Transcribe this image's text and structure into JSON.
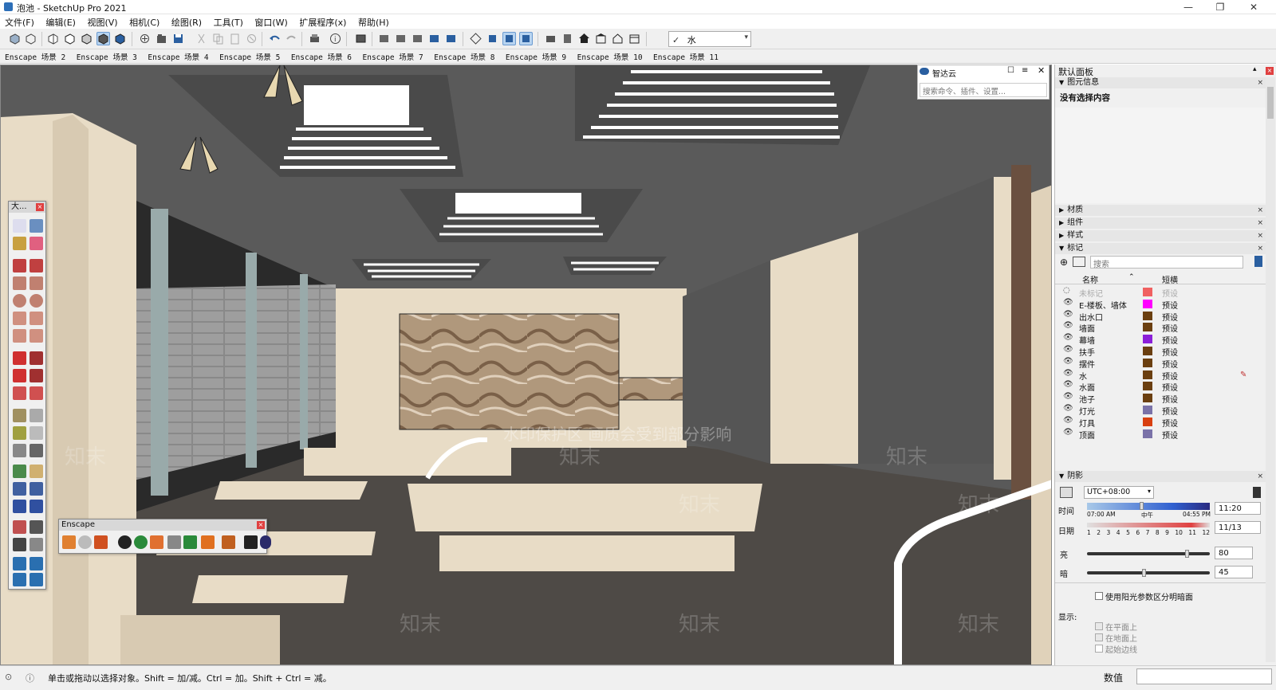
{
  "window": {
    "title": "泡池 - SketchUp Pro 2021",
    "minimize": "—",
    "maximize": "❐",
    "close": "✕"
  },
  "menu": [
    "文件(F)",
    "编辑(E)",
    "视图(V)",
    "相机(C)",
    "绘图(R)",
    "工具(T)",
    "窗口(W)",
    "扩展程序(x)",
    "帮助(H)"
  ],
  "layer_selector": {
    "check": "✓",
    "value": "水",
    "arrow": "▾"
  },
  "scenes": [
    "Enscape 场景 2",
    "Enscape 场景 3",
    "Enscape 场景 4",
    "Enscape 场景 5",
    "Enscape 场景 6",
    "Enscape 场景 7",
    "Enscape 场景 8",
    "Enscape 场景 9",
    "Enscape 场景 10",
    "Enscape 场景 11"
  ],
  "zhidayun": {
    "title": "智达云",
    "search_placeholder": "搜索命令、插件、设置..."
  },
  "tool_palette": {
    "title": "大..."
  },
  "enscape_toolbar": {
    "title": "Enscape"
  },
  "watermark": {
    "main": "水印保护区   画质会受到部分影响",
    "brand": "知末"
  },
  "right_panel": {
    "title": "默认面板",
    "pin": "▴",
    "entity_info": {
      "header": "图元信息",
      "empty": "没有选择内容"
    },
    "sections": [
      "材质",
      "组件",
      "样式",
      "标记"
    ],
    "tags": {
      "search_placeholder": "搜索",
      "col_name": "名称",
      "col_dash": "短横",
      "rows": [
        {
          "name": "未标记",
          "dash": "预设",
          "color": "#f06060",
          "dim": true
        },
        {
          "name": "E-楼板、墙体",
          "dash": "预设",
          "color": "#ff00ff",
          "dim": false
        },
        {
          "name": "出水口",
          "dash": "预设",
          "color": "#6b3f10",
          "dim": false
        },
        {
          "name": "墙面",
          "dash": "预设",
          "color": "#6b3f10",
          "dim": false
        },
        {
          "name": "幕墙",
          "dash": "预设",
          "color": "#8b1fd8",
          "dim": false
        },
        {
          "name": "扶手",
          "dash": "预设",
          "color": "#6b3f10",
          "dim": false
        },
        {
          "name": "摆件",
          "dash": "预设",
          "color": "#6b3f10",
          "dim": false
        },
        {
          "name": "水",
          "dash": "预设",
          "color": "#6b3f10",
          "dim": false
        },
        {
          "name": "水面",
          "dash": "预设",
          "color": "#6b3f10",
          "dim": false
        },
        {
          "name": "池子",
          "dash": "预设",
          "color": "#6b3f10",
          "dim": false
        },
        {
          "name": "灯光",
          "dash": "预设",
          "color": "#7a72a8",
          "dim": false
        },
        {
          "name": "灯具",
          "dash": "预设",
          "color": "#d84010",
          "dim": false
        },
        {
          "name": "顶面",
          "dash": "预设",
          "color": "#7a72a8",
          "dim": false
        }
      ]
    },
    "shadow": {
      "header": "阴影",
      "timezone": "UTC+08:00",
      "time_label": "时间",
      "time_start": "07:00 AM",
      "time_mid": "中午",
      "time_end": "04:55 PM",
      "time_value": "11:20",
      "time_fraction": 0.43,
      "date_label": "日期",
      "months": [
        "1",
        "2",
        "3",
        "4",
        "5",
        "6",
        "7",
        "8",
        "9",
        "10",
        "11",
        "12"
      ],
      "date_value": "11/13",
      "light_label": "亮",
      "light_value": "80",
      "light_fraction": 0.8,
      "dark_label": "暗",
      "dark_value": "45",
      "dark_fraction": 0.45,
      "use_sun_label": "使用阳光参数区分明暗面",
      "display_label": "显示:",
      "on_faces": "在平面上",
      "on_ground": "在地面上",
      "from_edges": "起始边线"
    }
  },
  "status": {
    "message": "单击或拖动以选择对象。Shift = 加/减。Ctrl = 加。Shift + Ctrl = 减。",
    "measurements_label": "数值"
  }
}
